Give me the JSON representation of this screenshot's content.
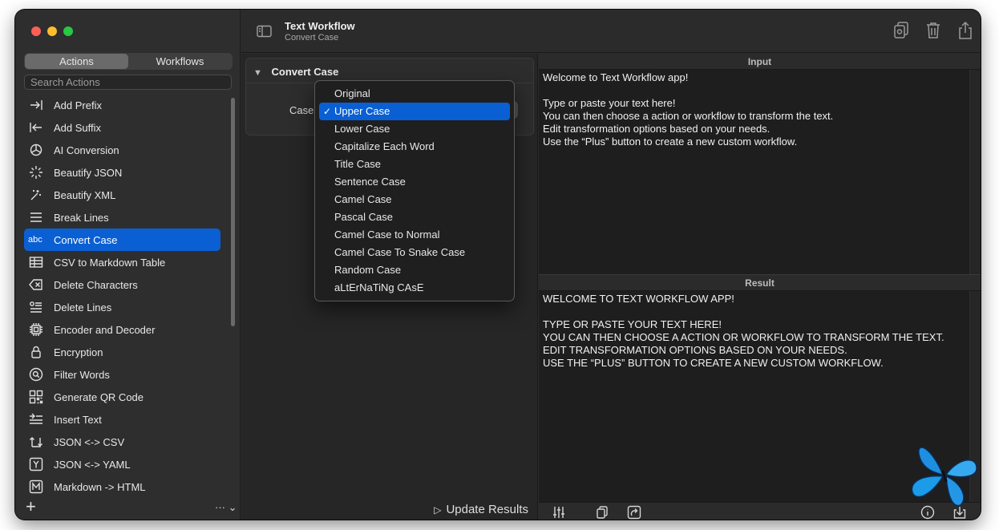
{
  "window": {
    "title": "Text Workflow",
    "subtitle": "Convert Case"
  },
  "sidebar": {
    "tabs": [
      {
        "label": "Actions",
        "active": true
      },
      {
        "label": "Workflows",
        "active": false
      }
    ],
    "search_placeholder": "Search Actions",
    "items": [
      {
        "label": "Add Prefix",
        "icon": "arrow-right-to-bar-icon"
      },
      {
        "label": "Add Suffix",
        "icon": "arrow-left-to-bar-icon"
      },
      {
        "label": "AI Conversion",
        "icon": "openai-icon"
      },
      {
        "label": "Beautify JSON",
        "icon": "sparkle-icon"
      },
      {
        "label": "Beautify XML",
        "icon": "magic-wand-icon"
      },
      {
        "label": "Break Lines",
        "icon": "lines-icon"
      },
      {
        "label": "Convert Case",
        "icon": "abc-icon",
        "icon_text": "abc",
        "selected": true
      },
      {
        "label": "CSV to Markdown Table",
        "icon": "table-icon"
      },
      {
        "label": "Delete Characters",
        "icon": "delete-left-icon"
      },
      {
        "label": "Delete Lines",
        "icon": "list-delete-icon"
      },
      {
        "label": "Encoder and Decoder",
        "icon": "cpu-icon"
      },
      {
        "label": "Encryption",
        "icon": "lock-icon"
      },
      {
        "label": "Filter Words",
        "icon": "magnifier-circle-icon"
      },
      {
        "label": "Generate QR Code",
        "icon": "qrcode-icon"
      },
      {
        "label": "Insert Text",
        "icon": "text-insert-icon"
      },
      {
        "label": "JSON <-> CSV",
        "icon": "swap-arrows-icon"
      },
      {
        "label": "JSON <-> YAML",
        "icon": "y-square-icon"
      },
      {
        "label": "Markdown -> HTML",
        "icon": "m-square-icon"
      }
    ],
    "add_label": "+",
    "more_label": "··· ⌄"
  },
  "action_panel": {
    "title": "Convert Case",
    "case_label": "Case:",
    "case_selected": "Upper Case",
    "update_label": "Update Results"
  },
  "case_menu": {
    "options": [
      "Original",
      "Upper Case",
      "Lower Case",
      "Capitalize Each Word",
      "Title Case",
      "Sentence Case",
      "Camel Case",
      "Pascal Case",
      "Camel Case to Normal",
      "Camel Case To Snake Case",
      "Random Case",
      "aLtErNaTiNg CAsE"
    ],
    "checked_index": 1,
    "check_glyph": "✓"
  },
  "input_pane": {
    "header": "Input",
    "text": "Welcome to Text Workflow app!\n\nType or paste your text here!\nYou can then choose a action or workflow to transform the text.\nEdit transformation options based on your needs.\nUse the “Plus” button to create a new custom workflow."
  },
  "result_pane": {
    "header": "Result",
    "text": "WELCOME TO TEXT WORKFLOW APP!\n\nTYPE OR PASTE YOUR TEXT HERE!\nYOU CAN THEN CHOOSE A ACTION OR WORKFLOW TO TRANSFORM THE TEXT.\nEDIT TRANSFORMATION OPTIONS BASED ON YOUR NEEDS.\nUSE THE “PLUS” BUTTON TO CREATE A NEW CUSTOM WORKFLOW."
  },
  "colors": {
    "accent": "#0a5fd3",
    "window_bg": "#2b2b2b",
    "pane_bg": "#1e1e1e"
  }
}
